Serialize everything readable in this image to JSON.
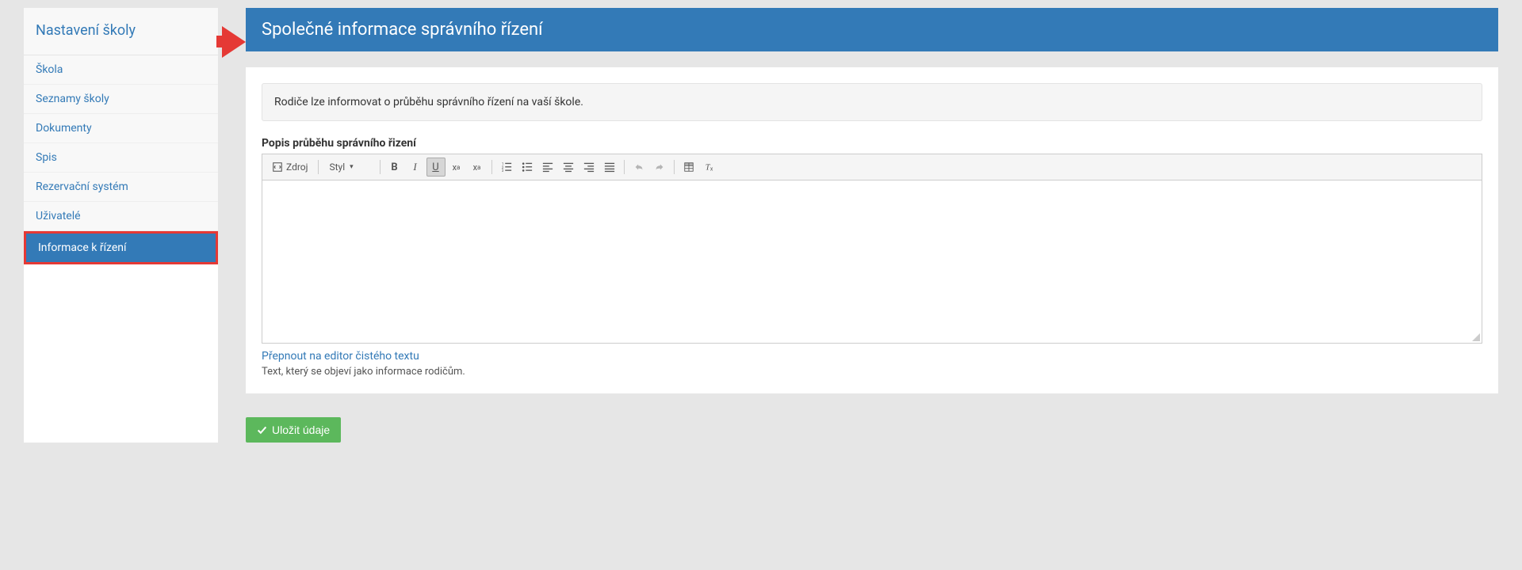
{
  "sidebar": {
    "title": "Nastavení školy",
    "items": [
      {
        "label": "Škola",
        "active": false
      },
      {
        "label": "Seznamy školy",
        "active": false
      },
      {
        "label": "Dokumenty",
        "active": false
      },
      {
        "label": "Spis",
        "active": false
      },
      {
        "label": "Rezervační systém",
        "active": false
      },
      {
        "label": "Uživatelé",
        "active": false
      },
      {
        "label": "Informace k řízení",
        "active": true
      }
    ]
  },
  "main": {
    "title": "Společné informace správního řízení",
    "info_text": "Rodiče lze informovat o průběhu správního řízení na vaší škole.",
    "field_label": "Popis průběhu správního řizení",
    "toolbar": {
      "source_label": "Zdroj",
      "styles_label": "Styl"
    },
    "switch_link": "Přepnout na editor čistého textu",
    "help_text": "Text, který se objeví jako informace rodičům.",
    "save_button": "Uložit údaje"
  }
}
